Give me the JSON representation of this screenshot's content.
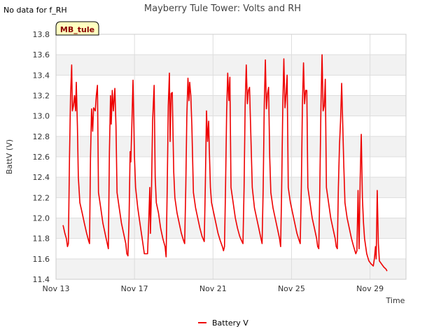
{
  "colors": {
    "series": "#ee0000",
    "band": "#f2f2f2",
    "grid": "#dddddd",
    "tag_fill": "#ffffc0"
  },
  "chart_data": {
    "type": "line",
    "title": "Mayberry Tule Tower: Volts and RH",
    "note": "No data for f_RH",
    "site_tag": "MB_tule",
    "xlabel": "Time",
    "ylabel": "BattV (V)",
    "ylim": [
      11.4,
      13.8
    ],
    "xlim": [
      "2023-11-13",
      "2023-11-30T20:00"
    ],
    "y_ticks": [
      11.4,
      11.6,
      11.8,
      12.0,
      12.2,
      12.4,
      12.6,
      12.8,
      13.0,
      13.2,
      13.4,
      13.6,
      13.8
    ],
    "x_ticks": [
      {
        "date": "2023-11-13",
        "label": "Nov 13"
      },
      {
        "date": "2023-11-17",
        "label": "Nov 17"
      },
      {
        "date": "2023-11-21",
        "label": "Nov 21"
      },
      {
        "date": "2023-11-25",
        "label": "Nov 25"
      },
      {
        "date": "2023-11-29",
        "label": "Nov 29"
      }
    ],
    "grid": true,
    "legend_position": "bottom-center",
    "series": [
      {
        "name": "Battery V",
        "points": [
          [
            "2023-11-13T08:40",
            11.93
          ],
          [
            "2023-11-13T10:50",
            11.85
          ],
          [
            "2023-11-13T12:40",
            11.8
          ],
          [
            "2023-11-13T14:00",
            11.72
          ],
          [
            "2023-11-13T15:10",
            11.75
          ],
          [
            "2023-11-13T16:30",
            12.6
          ],
          [
            "2023-11-13T17:50",
            13.2
          ],
          [
            "2023-11-13T19:10",
            13.5
          ],
          [
            "2023-11-13T20:00",
            13.05
          ],
          [
            "2023-11-13T21:20",
            13.1
          ],
          [
            "2023-11-13T22:40",
            13.2
          ],
          [
            "2023-11-14T00:00",
            13.05
          ],
          [
            "2023-11-14T00:50",
            13.33
          ],
          [
            "2023-11-14T02:10",
            12.9
          ],
          [
            "2023-11-14T03:20",
            12.4
          ],
          [
            "2023-11-14T05:10",
            12.15
          ],
          [
            "2023-11-14T08:00",
            12.05
          ],
          [
            "2023-11-14T10:40",
            11.95
          ],
          [
            "2023-11-14T13:30",
            11.85
          ],
          [
            "2023-11-14T15:50",
            11.78
          ],
          [
            "2023-11-14T17:00",
            11.75
          ],
          [
            "2023-11-14T18:10",
            12.6
          ],
          [
            "2023-11-14T19:30",
            13.07
          ],
          [
            "2023-11-14T20:50",
            12.85
          ],
          [
            "2023-11-14T22:00",
            13.08
          ],
          [
            "2023-11-15T00:00",
            13.05
          ],
          [
            "2023-11-15T01:20",
            13.2
          ],
          [
            "2023-11-15T02:40",
            13.3
          ],
          [
            "2023-11-15T04:00",
            12.25
          ],
          [
            "2023-11-15T06:40",
            12.1
          ],
          [
            "2023-11-15T09:20",
            11.95
          ],
          [
            "2023-11-15T12:00",
            11.85
          ],
          [
            "2023-11-15T14:40",
            11.75
          ],
          [
            "2023-11-15T16:00",
            11.7
          ],
          [
            "2023-11-15T17:20",
            12.65
          ],
          [
            "2023-11-15T18:40",
            13.2
          ],
          [
            "2023-11-15T19:30",
            12.92
          ],
          [
            "2023-11-15T20:50",
            13.25
          ],
          [
            "2023-11-15T22:10",
            13.05
          ],
          [
            "2023-11-16T00:00",
            13.27
          ],
          [
            "2023-11-16T01:20",
            12.9
          ],
          [
            "2023-11-16T02:40",
            12.25
          ],
          [
            "2023-11-16T05:20",
            12.1
          ],
          [
            "2023-11-16T08:00",
            11.95
          ],
          [
            "2023-11-16T10:40",
            11.85
          ],
          [
            "2023-11-16T13:20",
            11.75
          ],
          [
            "2023-11-16T14:40",
            11.65
          ],
          [
            "2023-11-16T16:00",
            11.63
          ],
          [
            "2023-11-16T17:20",
            12.0
          ],
          [
            "2023-11-16T18:40",
            12.65
          ],
          [
            "2023-11-16T19:30",
            12.55
          ],
          [
            "2023-11-16T20:50",
            12.95
          ],
          [
            "2023-11-16T22:10",
            13.35
          ],
          [
            "2023-11-17T00:00",
            12.6
          ],
          [
            "2023-11-17T01:20",
            12.3
          ],
          [
            "2023-11-17T04:00",
            12.1
          ],
          [
            "2023-11-17T06:40",
            11.95
          ],
          [
            "2023-11-17T09:20",
            11.8
          ],
          [
            "2023-11-17T12:00",
            11.65
          ],
          [
            "2023-11-17T16:00",
            11.65
          ],
          [
            "2023-11-17T17:20",
            11.95
          ],
          [
            "2023-11-17T18:40",
            12.3
          ],
          [
            "2023-11-17T19:30",
            11.85
          ],
          [
            "2023-11-17T20:50",
            12.3
          ],
          [
            "2023-11-17T22:10",
            12.95
          ],
          [
            "2023-11-18T00:00",
            13.3
          ],
          [
            "2023-11-18T01:20",
            12.4
          ],
          [
            "2023-11-18T02:40",
            12.15
          ],
          [
            "2023-11-18T05:20",
            12.05
          ],
          [
            "2023-11-18T08:00",
            11.9
          ],
          [
            "2023-11-18T10:40",
            11.8
          ],
          [
            "2023-11-18T13:20",
            11.72
          ],
          [
            "2023-11-18T14:40",
            11.62
          ],
          [
            "2023-11-18T16:00",
            12.3
          ],
          [
            "2023-11-18T17:20",
            13.1
          ],
          [
            "2023-11-18T18:40",
            13.42
          ],
          [
            "2023-11-18T19:30",
            12.75
          ],
          [
            "2023-11-18T20:50",
            13.22
          ],
          [
            "2023-11-18T22:10",
            13.23
          ],
          [
            "2023-11-19T00:00",
            12.45
          ],
          [
            "2023-11-19T01:20",
            12.2
          ],
          [
            "2023-11-19T04:00",
            12.05
          ],
          [
            "2023-11-19T06:40",
            11.95
          ],
          [
            "2023-11-19T09:20",
            11.85
          ],
          [
            "2023-11-19T12:00",
            11.78
          ],
          [
            "2023-11-19T13:20",
            11.75
          ],
          [
            "2023-11-19T14:40",
            12.3
          ],
          [
            "2023-11-19T16:00",
            13.0
          ],
          [
            "2023-11-19T17:20",
            13.37
          ],
          [
            "2023-11-19T18:40",
            13.15
          ],
          [
            "2023-11-19T19:30",
            13.33
          ],
          [
            "2023-11-19T20:50",
            13.2
          ],
          [
            "2023-11-19T22:10",
            12.9
          ],
          [
            "2023-11-20T00:00",
            12.25
          ],
          [
            "2023-11-20T02:40",
            12.1
          ],
          [
            "2023-11-20T05:20",
            12.0
          ],
          [
            "2023-11-20T08:00",
            11.9
          ],
          [
            "2023-11-20T10:40",
            11.82
          ],
          [
            "2023-11-20T13:20",
            11.77
          ],
          [
            "2023-11-20T14:40",
            12.35
          ],
          [
            "2023-11-20T16:00",
            13.05
          ],
          [
            "2023-11-20T17:20",
            12.75
          ],
          [
            "2023-11-20T18:40",
            12.95
          ],
          [
            "2023-11-20T19:30",
            12.68
          ],
          [
            "2023-11-20T20:50",
            12.3
          ],
          [
            "2023-11-20T22:10",
            12.15
          ],
          [
            "2023-11-21T00:50",
            12.05
          ],
          [
            "2023-11-21T03:30",
            11.95
          ],
          [
            "2023-11-21T06:10",
            11.85
          ],
          [
            "2023-11-21T08:50",
            11.78
          ],
          [
            "2023-11-21T11:30",
            11.72
          ],
          [
            "2023-11-21T12:50",
            11.68
          ],
          [
            "2023-11-21T14:00",
            11.72
          ],
          [
            "2023-11-21T15:20",
            12.3
          ],
          [
            "2023-11-21T16:40",
            13.05
          ],
          [
            "2023-11-21T18:00",
            13.42
          ],
          [
            "2023-11-21T19:20",
            13.15
          ],
          [
            "2023-11-21T20:40",
            13.38
          ],
          [
            "2023-11-21T22:00",
            12.3
          ],
          [
            "2023-11-22T00:40",
            12.15
          ],
          [
            "2023-11-22T03:20",
            12.0
          ],
          [
            "2023-11-22T06:00",
            11.9
          ],
          [
            "2023-11-22T08:40",
            11.82
          ],
          [
            "2023-11-22T11:20",
            11.77
          ],
          [
            "2023-11-22T12:40",
            11.75
          ],
          [
            "2023-11-22T14:00",
            12.3
          ],
          [
            "2023-11-22T15:20",
            13.1
          ],
          [
            "2023-11-22T16:40",
            13.5
          ],
          [
            "2023-11-22T18:00",
            13.12
          ],
          [
            "2023-11-22T19:20",
            13.25
          ],
          [
            "2023-11-22T20:40",
            13.28
          ],
          [
            "2023-11-22T22:00",
            12.9
          ],
          [
            "2023-11-23T00:00",
            12.3
          ],
          [
            "2023-11-23T02:40",
            12.1
          ],
          [
            "2023-11-23T05:20",
            12.0
          ],
          [
            "2023-11-23T08:00",
            11.9
          ],
          [
            "2023-11-23T10:40",
            11.8
          ],
          [
            "2023-11-23T12:00",
            11.75
          ],
          [
            "2023-11-23T13:20",
            12.3
          ],
          [
            "2023-11-23T14:40",
            13.1
          ],
          [
            "2023-11-23T16:00",
            13.55
          ],
          [
            "2023-11-23T17:20",
            13.07
          ],
          [
            "2023-11-23T18:40",
            13.22
          ],
          [
            "2023-11-23T20:00",
            13.28
          ],
          [
            "2023-11-23T21:20",
            12.6
          ],
          [
            "2023-11-23T22:40",
            12.25
          ],
          [
            "2023-11-24T01:20",
            12.1
          ],
          [
            "2023-11-24T04:00",
            12.0
          ],
          [
            "2023-11-24T06:40",
            11.9
          ],
          [
            "2023-11-24T09:20",
            11.8
          ],
          [
            "2023-11-24T10:40",
            11.72
          ],
          [
            "2023-11-24T12:00",
            12.3
          ],
          [
            "2023-11-24T13:20",
            13.1
          ],
          [
            "2023-11-24T14:40",
            13.56
          ],
          [
            "2023-11-24T16:00",
            13.08
          ],
          [
            "2023-11-24T17:20",
            13.22
          ],
          [
            "2023-11-24T18:40",
            13.4
          ],
          [
            "2023-11-24T20:00",
            12.3
          ],
          [
            "2023-11-24T22:40",
            12.15
          ],
          [
            "2023-11-25T01:20",
            12.05
          ],
          [
            "2023-11-25T04:00",
            11.95
          ],
          [
            "2023-11-25T06:40",
            11.85
          ],
          [
            "2023-11-25T09:20",
            11.78
          ],
          [
            "2023-11-25T10:40",
            11.75
          ],
          [
            "2023-11-25T12:00",
            12.3
          ],
          [
            "2023-11-25T13:20",
            13.1
          ],
          [
            "2023-11-25T14:40",
            13.52
          ],
          [
            "2023-11-25T16:00",
            13.12
          ],
          [
            "2023-11-25T17:20",
            13.25
          ],
          [
            "2023-11-25T18:40",
            13.25
          ],
          [
            "2023-11-25T20:00",
            12.3
          ],
          [
            "2023-11-25T22:40",
            12.15
          ],
          [
            "2023-11-26T01:20",
            12.0
          ],
          [
            "2023-11-26T04:00",
            11.9
          ],
          [
            "2023-11-26T06:40",
            11.8
          ],
          [
            "2023-11-26T08:00",
            11.72
          ],
          [
            "2023-11-26T09:20",
            11.7
          ],
          [
            "2023-11-26T10:40",
            12.3
          ],
          [
            "2023-11-26T12:00",
            13.1
          ],
          [
            "2023-11-26T13:20",
            13.6
          ],
          [
            "2023-11-26T14:40",
            13.05
          ],
          [
            "2023-11-26T16:00",
            13.1
          ],
          [
            "2023-11-26T17:20",
            13.36
          ],
          [
            "2023-11-26T18:40",
            12.3
          ],
          [
            "2023-11-26T21:20",
            12.15
          ],
          [
            "2023-11-27T00:00",
            12.0
          ],
          [
            "2023-11-27T02:40",
            11.9
          ],
          [
            "2023-11-27T05:20",
            11.8
          ],
          [
            "2023-11-27T06:40",
            11.72
          ],
          [
            "2023-11-27T08:00",
            11.7
          ],
          [
            "2023-11-27T09:20",
            12.3
          ],
          [
            "2023-11-27T10:40",
            12.72
          ],
          [
            "2023-11-27T12:00",
            12.95
          ],
          [
            "2023-11-27T13:20",
            13.32
          ],
          [
            "2023-11-27T14:40",
            12.9
          ],
          [
            "2023-11-27T16:00",
            12.5
          ],
          [
            "2023-11-27T17:20",
            12.15
          ],
          [
            "2023-11-27T20:00",
            12.0
          ],
          [
            "2023-11-27T22:40",
            11.9
          ],
          [
            "2023-11-28T01:20",
            11.8
          ],
          [
            "2023-11-28T04:00",
            11.72
          ],
          [
            "2023-11-28T06:40",
            11.65
          ],
          [
            "2023-11-28T08:00",
            11.68
          ],
          [
            "2023-11-28T09:20",
            12.27
          ],
          [
            "2023-11-28T10:40",
            11.7
          ],
          [
            "2023-11-28T12:00",
            12.4
          ],
          [
            "2023-11-28T13:20",
            12.82
          ],
          [
            "2023-11-28T14:40",
            12.2
          ],
          [
            "2023-11-28T16:00",
            11.95
          ],
          [
            "2023-11-28T17:20",
            11.8
          ],
          [
            "2023-11-28T20:00",
            11.65
          ],
          [
            "2023-11-28T22:40",
            11.58
          ],
          [
            "2023-11-29T01:20",
            11.55
          ],
          [
            "2023-11-29T04:00",
            11.53
          ],
          [
            "2023-11-29T05:20",
            11.6
          ],
          [
            "2023-11-29T06:40",
            11.72
          ],
          [
            "2023-11-29T07:30",
            11.6
          ],
          [
            "2023-11-29T08:50",
            12.27
          ],
          [
            "2023-11-29T10:10",
            11.75
          ],
          [
            "2023-11-29T11:30",
            11.58
          ],
          [
            "2023-11-29T14:10",
            11.55
          ],
          [
            "2023-11-29T16:50",
            11.52
          ],
          [
            "2023-11-29T19:30",
            11.5
          ],
          [
            "2023-11-29T20:50",
            11.48
          ]
        ]
      }
    ]
  }
}
